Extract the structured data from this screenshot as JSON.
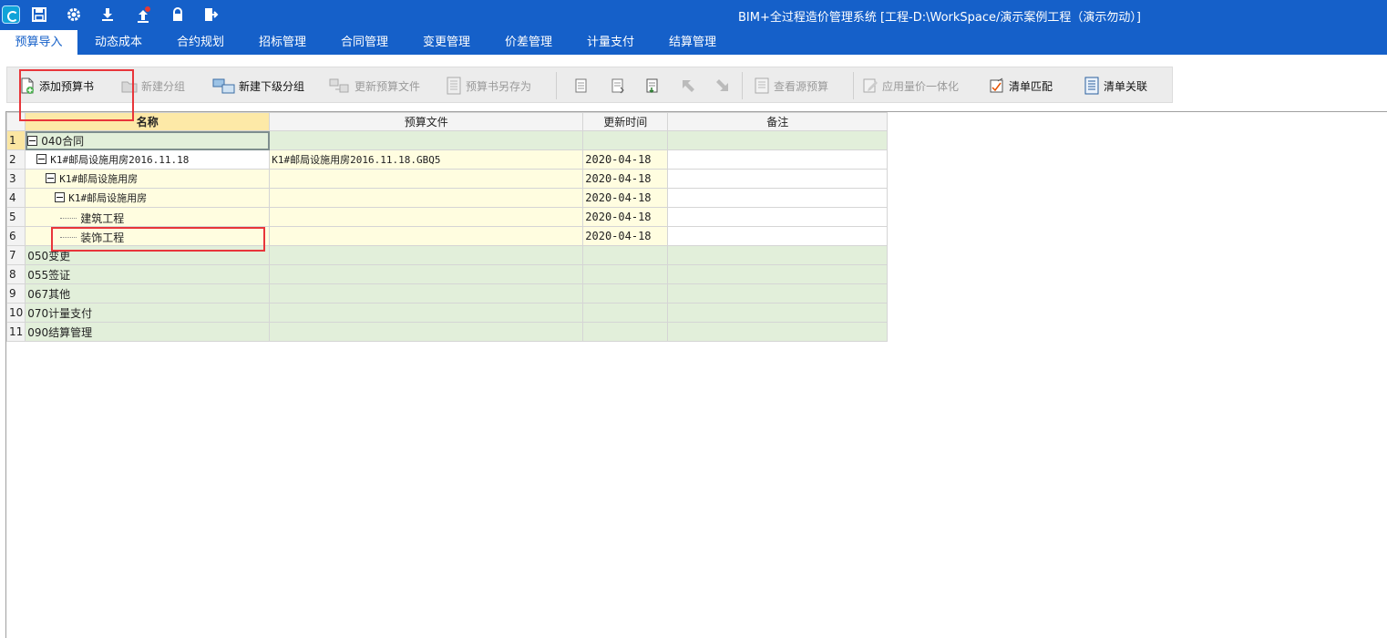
{
  "window": {
    "title": "BIM+全过程造价管理系统 [工程-D:\\WorkSpace/演示案例工程（演示勿动）]"
  },
  "quick_access": [
    {
      "name": "save-icon"
    },
    {
      "name": "gear-icon"
    },
    {
      "name": "download-icon"
    },
    {
      "name": "upload-icon"
    },
    {
      "name": "lock-icon"
    },
    {
      "name": "exit-icon"
    }
  ],
  "menu": {
    "tabs": [
      "预算导入",
      "动态成本",
      "合约规划",
      "招标管理",
      "合同管理",
      "变更管理",
      "价差管理",
      "计量支付",
      "结算管理"
    ],
    "active": "预算导入"
  },
  "toolbar": {
    "add_budget": "添加预算书",
    "new_group": "新建分组",
    "new_subgroup": "新建下级分组",
    "update_budget_file": "更新预算文件",
    "save_budget_as": "预算书另存为",
    "view_source_budget": "查看源预算",
    "apply_qty_price": "应用量价一体化",
    "list_match": "清单匹配",
    "list_link": "清单关联"
  },
  "grid": {
    "headers": {
      "name": "名称",
      "file": "预算文件",
      "updated": "更新时间",
      "note": "备注"
    },
    "rows": [
      {
        "no": "1",
        "name": "040合同",
        "file": "",
        "updated": "",
        "note": ""
      },
      {
        "no": "2",
        "name": "K1#邮局设施用房2016.11.18",
        "file": "K1#邮局设施用房2016.11.18.GBQ5",
        "updated": "2020-04-18",
        "note": ""
      },
      {
        "no": "3",
        "name": "K1#邮局设施用房",
        "file": "",
        "updated": "2020-04-18",
        "note": ""
      },
      {
        "no": "4",
        "name": "K1#邮局设施用房",
        "file": "",
        "updated": "2020-04-18",
        "note": ""
      },
      {
        "no": "5",
        "name": "建筑工程",
        "file": "",
        "updated": "2020-04-18",
        "note": ""
      },
      {
        "no": "6",
        "name": "装饰工程",
        "file": "",
        "updated": "2020-04-18",
        "note": ""
      },
      {
        "no": "7",
        "name": "050变更",
        "file": "",
        "updated": "",
        "note": ""
      },
      {
        "no": "8",
        "name": "055签证",
        "file": "",
        "updated": "",
        "note": ""
      },
      {
        "no": "9",
        "name": "067其他",
        "file": "",
        "updated": "",
        "note": ""
      },
      {
        "no": "10",
        "name": "070计量支付",
        "file": "",
        "updated": "",
        "note": ""
      },
      {
        "no": "11",
        "name": "090结算管理",
        "file": "",
        "updated": "",
        "note": ""
      }
    ]
  },
  "colors": {
    "title_bar": "#1560c9",
    "group_row": "#e2efda",
    "budget_row": "#fffde0",
    "annotation": "#e8353a"
  }
}
